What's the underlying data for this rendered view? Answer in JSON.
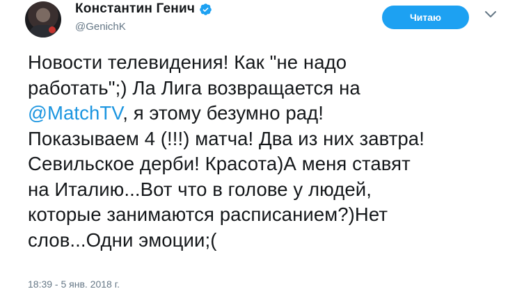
{
  "author": {
    "display_name": "Константин Генич",
    "handle": "@GenichK",
    "verified": true
  },
  "follow_button": {
    "label": "Читаю"
  },
  "tweet": {
    "lines": [
      {
        "text": "Новости телевидения! Как \"не надо"
      },
      {
        "text": "работать\";) Ла Лига возвращается на"
      },
      {
        "mention": "@MatchTV",
        "text": ", я этому безумно рад!"
      },
      {
        "text": "Показываем 4 (!!!) матча! Два из них завтра!"
      },
      {
        "text": "Севильское дерби! Красота)А меня ставят"
      },
      {
        "text": "на Италию...Вот что в голове у людей,"
      },
      {
        "text": "которые занимаются расписанием?)Нет"
      },
      {
        "text": "слов...Одни эмоции;("
      }
    ]
  },
  "timestamp": "18:39 - 5 янв. 2018 г.",
  "colors": {
    "accent": "#1da1f2",
    "link": "#1b95e0",
    "text": "#14171a",
    "muted": "#657786"
  },
  "icons": {
    "verified": "verified-badge-icon",
    "menu": "chevron-down-icon"
  }
}
